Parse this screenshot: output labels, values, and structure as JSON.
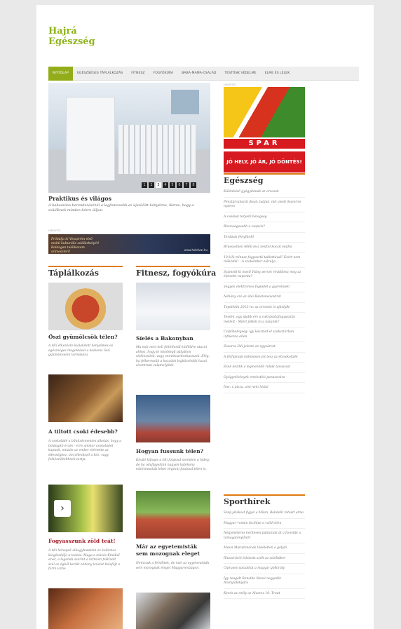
{
  "site": {
    "logo_line1": "Hajrá",
    "logo_line2": "Egészség"
  },
  "nav": [
    "NYITÓLAP",
    "EGÉSZSÉGES TÁPLÁLKOZÁS",
    "FITNESZ",
    "FOGYÓKÚRA",
    "BABA-MAMA-CSALÁD",
    "TESTÜNK VÉDELME",
    "ELME ÉS LÉLEK"
  ],
  "slider": {
    "pages": [
      "1",
      "2",
      "3",
      "4",
      "5",
      "6",
      "7",
      "8"
    ],
    "active_page": "3",
    "title": "Praktikus és világos",
    "desc": "A babaszoba berendezésénél a legfontosabb az újszülött kényelme, illetve, hogy a szülőknek minden kézre álljon."
  },
  "ads": {
    "label": "HIRDETÉS",
    "banner_text": "Próbálja ki Veszprém első mobil kulturális szálláshelyét! Boldogan találkozom szilveszteri!",
    "banner_url": "www.hotelvar.hu",
    "spar_logo": "SPAR",
    "spar_slogan": "JÓ HELY, JÓ ÁR, JÓ DÖNTÉS!"
  },
  "sections": {
    "taplalkozas": "Táplálkozás",
    "fitnesz": "Fitnesz, fogyókúra",
    "egeszseg": "Egészség",
    "sporthirek": "Sporthírek"
  },
  "left_articles": [
    {
      "title": "Őszi gyümölcsök télen?",
      "desc": "A téli étkezésre kialakított kényelmes és egészséges megoldásai a kedvenc őszi gyümölcseink tárolására."
    },
    {
      "title": "A tiltott csoki édesebb?",
      "desc": "A csokoládé a bűnözésmentes alkotás, hogy a boldogító érzés - erre amikor csokoládét kapunk, miután az ember elértette az édességhez, ám ellenkező a kéz, vagy felkészültebbnek tartja."
    },
    {
      "title": "Fogyasszunk zöld teát!",
      "desc": "A téli hónapok elhagyhatatlan és kellemes kiegészítője a teázás. Maga a teázás Kínából ered, a legenda szerint a hírtelen felkínált szél az égből került néhány levelet belefújt a forró vízbe."
    }
  ],
  "mid_articles": [
    {
      "title": "Síelés a Bakonyban",
      "desc": "Ma már nem kell feltétlenül külföldre utazni ahhoz, hogy jó minőségű pályákon síelhessünk, vagy snowboardozhassunk. Elég, ha felkeressük a hozzánk legközelebbi hazai sícentrum valamelyikét."
    },
    {
      "title": "Hogyan fussunk télen?",
      "desc": "Kiváló kifogás a téli futással szemben a hideg, de ha odafigyelünk nagyon hatékony edzésmunkát lehet végezni futással télen is."
    },
    {
      "title": "Már az egyetemisták sem mozognak eleget",
      "desc": "Nemcsak a felnőttek, de már az egyetemisták sem mozognak eleget Magyarországon."
    }
  ],
  "egeszseg_list": [
    "Különböző gyógyítanak az orvosok",
    "Pénztárcabarát divat: tudjuk, mit viselj ősszel és nyáron",
    "A csókkal terjedő betegség",
    "Bizonságosabb a csapvíz?",
    "Terápiás fényfürdő",
    "Brüsszelben 6000 lesz testtel kocsit eladni",
    "10 kiló mínusz fogyasztó tablettával? Ezért nem működik! - A szakember elárulja",
    "Számold ki most! Hány percet rövidítesz meg az életedet naponta?",
    "Vegyen elektromos fogkefét a gyereknek!",
    "Néhány szó az idei Balatonsoundról",
    "Topdiéták 2013-ra: az orvosok is ajánlják!",
    "Tessék, egy újabb érv a cukrászdafogyasztás mellett - Miért jöttek rá a kutatók?",
    "Csípőbetegség: így készítsd el szaksztárban influenza ellen",
    "Zavaros Ildi jelezte az egyvárost",
    "A férfiaknak különösen jót tesz az étcsokoládé",
    "Ezek kezdik a legmenőbb ruhák tavasszal",
    "Gyógynövények emésztési panaszokra",
    "Íme, a pizza, ami nem hízlal"
  ],
  "sport_list": [
    "Szép játékost figyel a Milan, Balotelli rohadt alma",
    "Magyar–román focilépe a csőd ellen",
    "Négyméteres kerítésen pattantak át a focisták a támogatónyiltért",
    "Messi Maradonának tökéletlen a gólján",
    "Illusztráció hibázott szólt az edzőtábor",
    "Cipruson ipszalhat a magyar gólkirály",
    "Így reagált Ronaldo Messi negyedik Aranylabdájára",
    "Kevés az esély az Alvarez 10. Trout"
  ]
}
